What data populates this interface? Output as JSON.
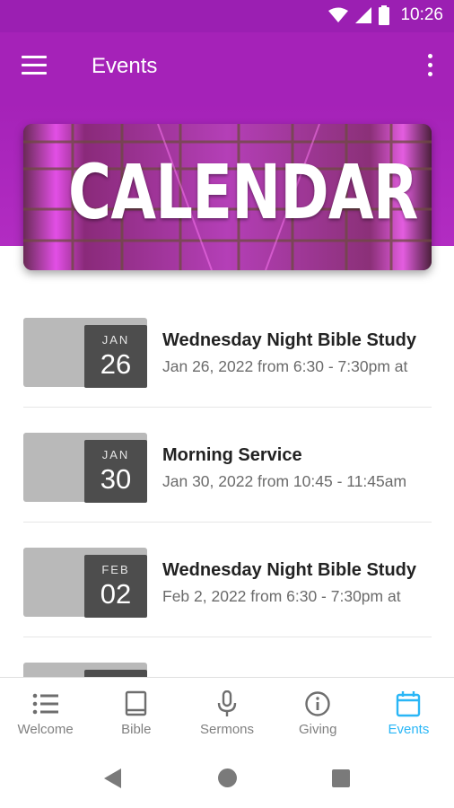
{
  "status_bar": {
    "time": "10:26"
  },
  "app_bar": {
    "title": "Events"
  },
  "banner": {
    "text": "CALENDAR"
  },
  "events": [
    {
      "month": "JAN",
      "day": "26",
      "name": "Wednesday Night Bible Study",
      "when": "Jan 26, 2022 from 6:30 - 7:30pm at"
    },
    {
      "month": "JAN",
      "day": "30",
      "name": "Morning Service",
      "when": "Jan 30, 2022 from 10:45 - 11:45am"
    },
    {
      "month": "FEB",
      "day": "02",
      "name": "Wednesday Night Bible Study",
      "when": "Feb 2, 2022 from 6:30 - 7:30pm at"
    }
  ],
  "bottom_nav": [
    {
      "label": "Welcome",
      "icon": "list-icon"
    },
    {
      "label": "Bible",
      "icon": "book-icon"
    },
    {
      "label": "Sermons",
      "icon": "microphone-icon"
    },
    {
      "label": "Giving",
      "icon": "info-icon"
    },
    {
      "label": "Events",
      "icon": "calendar-icon",
      "active": true
    }
  ],
  "colors": {
    "primary": "#a522b8",
    "status_bar": "#9b1fb2",
    "accent": "#29b6f6",
    "date_box": "#4d4d4d"
  }
}
